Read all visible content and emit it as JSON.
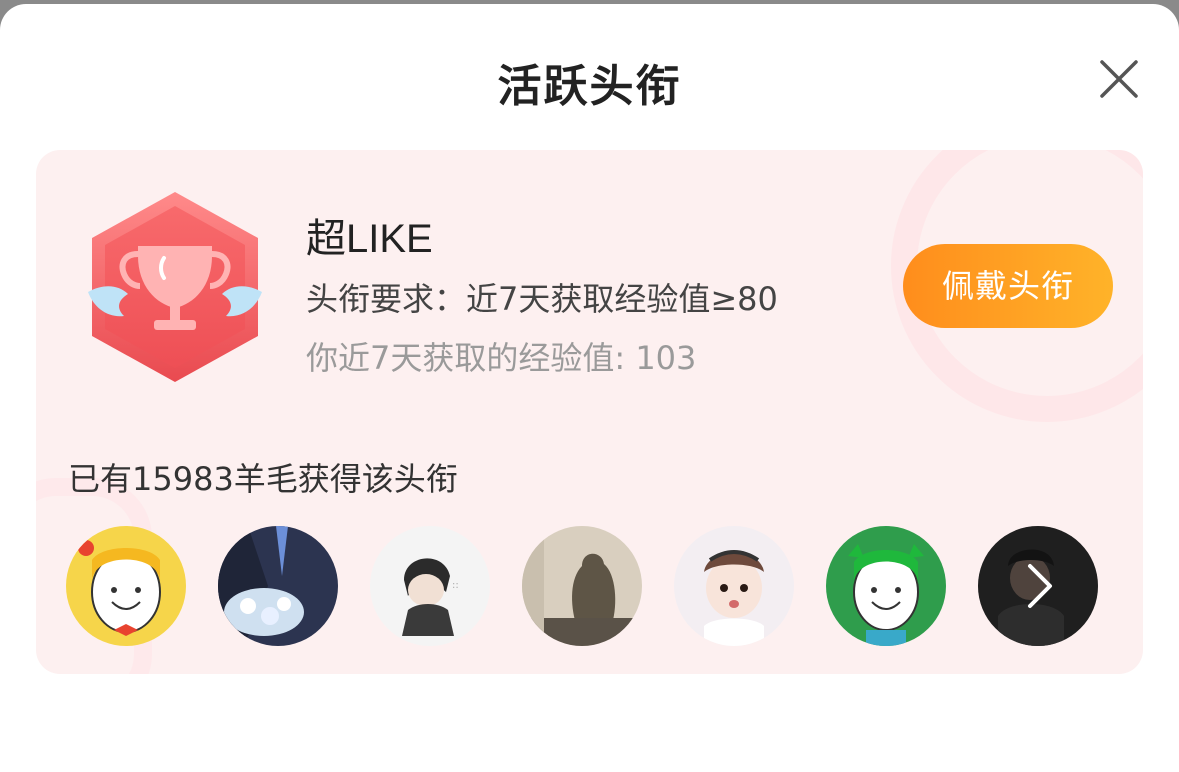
{
  "header": {
    "title": "活跃头衔"
  },
  "badge": {
    "name": "超LIKE",
    "requirement": "头衔要求：近7天获取经验值≥80",
    "user_exp": "你近7天获取的经验值: 103",
    "action_label": "佩戴头衔",
    "icon": "trophy-icon"
  },
  "holders": {
    "summary": "已有15983羊毛获得该头衔",
    "avatars": [
      "cartoon-yellow-hair-avatar",
      "suit-bouquet-avatar",
      "anime-boy-avatar",
      "shadow-photo-avatar",
      "baby-photo-avatar",
      "cartoon-green-hair-avatar",
      "dark-photo-avatar"
    ]
  },
  "colors": {
    "accent_start": "#ff8d1c",
    "accent_end": "#ffb329",
    "card_bg": "#fdf0f0",
    "badge_red": "#f2585a"
  }
}
